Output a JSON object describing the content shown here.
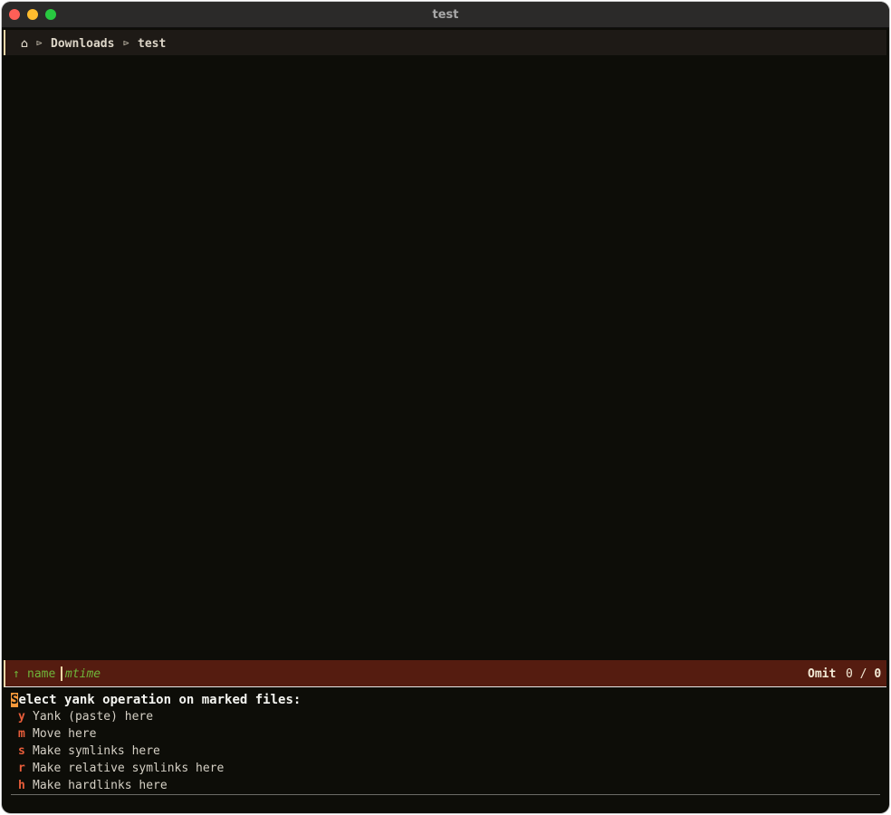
{
  "window": {
    "title": "test"
  },
  "pathbar": {
    "home_icon": "⌂",
    "separator": "⊳",
    "segments": [
      "Downloads",
      "test"
    ]
  },
  "statusbar": {
    "sort_arrow": "↑",
    "sort_name": "name",
    "sort_time": "mtime",
    "omit_label": "Omit",
    "omit_count": "0 /",
    "omit_total": "0"
  },
  "prompt": {
    "heading_first": "S",
    "heading_rest": "elect yank operation on marked files:",
    "options": [
      {
        "key": "y",
        "label": "Yank (paste) here"
      },
      {
        "key": "m",
        "label": "Move here"
      },
      {
        "key": "s",
        "label": "Make symlinks here"
      },
      {
        "key": "r",
        "label": "Make relative symlinks here"
      },
      {
        "key": "h",
        "label": "Make hardlinks here"
      }
    ]
  },
  "colors": {
    "background": "#0d0d08",
    "statusbar": "#551c10",
    "accent_green": "#6fb53a",
    "key_red": "#e85d3a",
    "cursor_orange": "#f7993a"
  }
}
